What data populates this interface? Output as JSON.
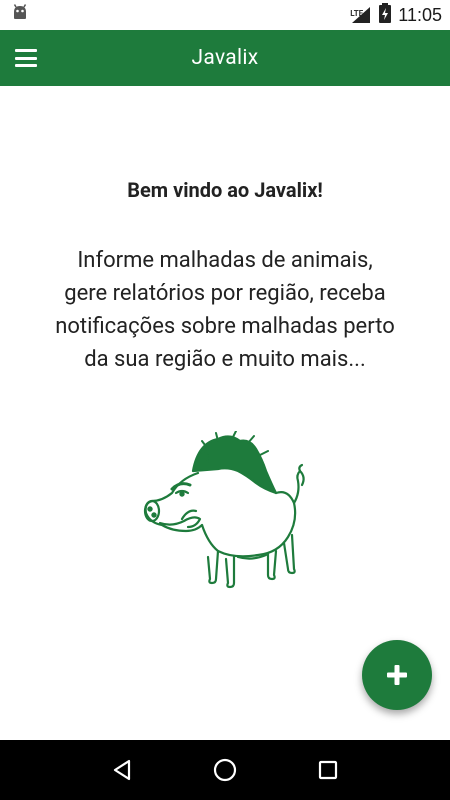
{
  "status_bar": {
    "time": "11:05",
    "network": "LTE",
    "icons": [
      "android-debug-icon",
      "signal-icon",
      "battery-icon"
    ]
  },
  "app_bar": {
    "title": "Javalix",
    "menu_icon": "hamburger-menu-icon",
    "background": "#1e7b3c"
  },
  "main": {
    "welcome_title": "Bem vindo ao Javalix!",
    "welcome_lines": [
      "Informe malhadas de animais,",
      "gere relatórios por região, receba",
      "notificações sobre malhadas perto",
      "da sua região e muito mais..."
    ],
    "illustration": "wild-boar-illustration"
  },
  "fab": {
    "icon": "plus-icon",
    "color": "#1e7b3c"
  },
  "nav_bar": {
    "buttons": [
      "back-icon",
      "home-icon",
      "recents-icon"
    ]
  }
}
